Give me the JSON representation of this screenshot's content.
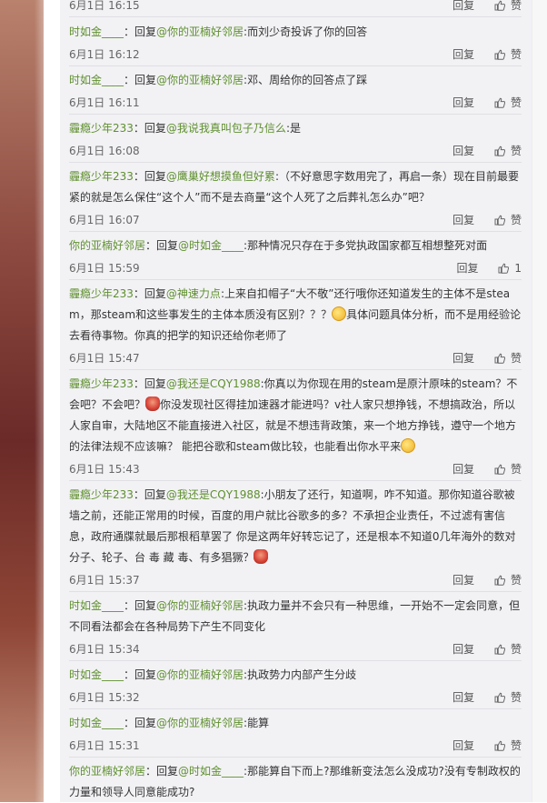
{
  "actions": {
    "reply_label": "回复",
    "like_label": "赞"
  },
  "comments": [
    {
      "user": "",
      "label": "",
      "target": "",
      "text": "",
      "time": "6月1日 16:15",
      "likes": ""
    },
    {
      "user": "时如金____",
      "label": "：回复",
      "target": "@你的亚楠好邻居",
      "text": ":而刘少奇投诉了你的回答",
      "time": "6月1日 16:12",
      "likes": ""
    },
    {
      "user": "时如金____",
      "label": "：回复",
      "target": "@你的亚楠好邻居",
      "text": ":邓、周给你的回答点了踩",
      "time": "6月1日 16:11",
      "likes": ""
    },
    {
      "user": "霾瘾少年233",
      "label": "：回复",
      "target": "@我说我真叫包子乃信么",
      "text": ":是",
      "time": "6月1日 16:08",
      "likes": ""
    },
    {
      "user": "霾瘾少年233",
      "label": "：回复",
      "target": "@鹰巢好想摸鱼但好累",
      "text": ":（不好意思字数用完了，再启一条）现在目前最要紧的就是怎么保住“这个人”而不是去商量“这个人死了之后葬礼怎么办”吧？",
      "time": "6月1日 16:07",
      "likes": ""
    },
    {
      "user": "你的亚楠好邻居",
      "label": "：回复",
      "target": "@时如金____",
      "text": ":那种情况只存在于多党执政国家都互相想整死对面",
      "time": "6月1日 15:59",
      "likes": "1"
    },
    {
      "user": "霾瘾少年233",
      "label": "：回复",
      "target": "@神速力点",
      "text": ":上来自扣帽子“大不敬”还行哦你还知道发生的主体不是steam，那steam和这些事发生的主体本质没有区别？？？",
      "text2": "具体问题具体分析，而不是用经验论去看待事物。你真的把学的知识还给你老师了",
      "time": "6月1日 15:47",
      "likes": ""
    },
    {
      "user": "霾瘾少年233",
      "label": "：回复",
      "target": "@我还是CQY1988",
      "text": ":你真以为你现在用的steam是原汁原味的steam？不会吧？不会吧？",
      "text2": "你没发现社区得挂加速器才能进吗？v社人家只想挣钱，不想搞政治，所以人家自审，大陆地区不能直接进入社区，就是不想违背政策，来一个地方挣钱，遵守一个地方的法律法规不应该嘛？ 能把谷歌和steam做比较，也能看出你水平来",
      "time": "6月1日 15:43",
      "likes": ""
    },
    {
      "user": "霾瘾少年233",
      "label": "：回复",
      "target": "@我还是CQY1988",
      "text": ":小朋友了还行，知道啊，咋不知道。那你知道谷歌被墙之前，还能正常用的时候，百度的用户就比谷歌多的多？不承担企业责任，不过滤有害信息，政府通牒就最后那根稻草罢了 你是这两年好转忘记了，还是根本不知道0几年海外的数对分子、轮子、台 毒 藏 毒、有多猖獗？",
      "time": "6月1日 15:37",
      "likes": ""
    },
    {
      "user": "时如金____",
      "label": "：回复",
      "target": "@你的亚楠好邻居",
      "text": ":执政力量并不会只有一种思维，一开始不一定会同意，但不同看法都会在各种局势下产生不同变化",
      "time": "6月1日 15:34",
      "likes": ""
    },
    {
      "user": "时如金____",
      "label": "：回复",
      "target": "@你的亚楠好邻居",
      "text": ":执政势力内部产生分歧",
      "time": "6月1日 15:32",
      "likes": ""
    },
    {
      "user": "时如金____",
      "label": "：回复",
      "target": "@你的亚楠好邻居",
      "text": ":能算",
      "time": "6月1日 15:31",
      "likes": ""
    },
    {
      "user": "你的亚楠好邻居",
      "label": "：回复",
      "target": "@时如金____",
      "text": ":那能算自下而上?那维新变法怎么没成功?没有专制政权的力量和领导人同意能成功?",
      "time": "",
      "likes": ""
    }
  ]
}
